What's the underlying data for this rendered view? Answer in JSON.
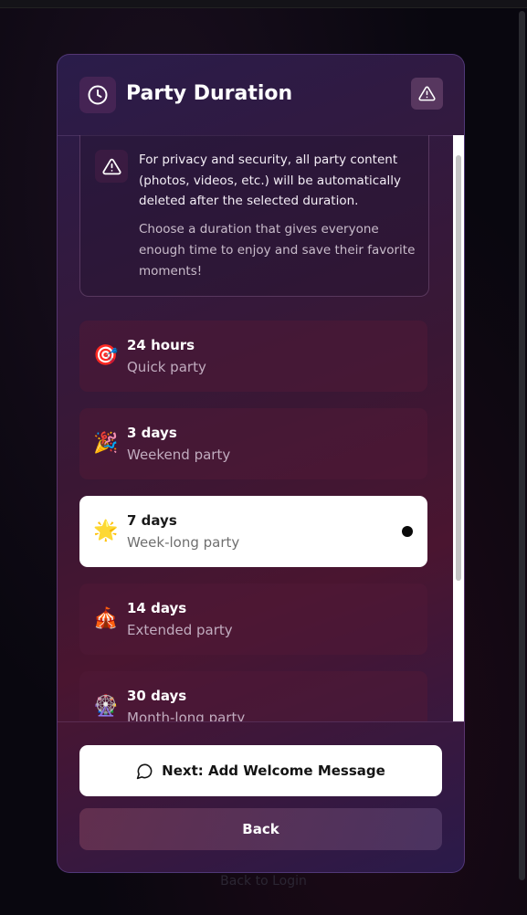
{
  "background": {
    "link_text": "Back to Login"
  },
  "modal": {
    "title": "Party Duration",
    "header_icon": "clock-icon",
    "header_button_icon": "warning-icon",
    "info": {
      "icon": "warning-icon",
      "paragraph1": "For privacy and security, all party content (photos, videos, etc.) will be automatically deleted after the selected duration.",
      "paragraph2": "Choose a duration that gives everyone enough time to enjoy and save their favorite moments!"
    },
    "options": [
      {
        "emoji": "🎯",
        "title": "24 hours",
        "subtitle": "Quick party",
        "selected": false
      },
      {
        "emoji": "🎉",
        "title": "3 days",
        "subtitle": "Weekend party",
        "selected": false
      },
      {
        "emoji": "🌟",
        "title": "7 days",
        "subtitle": "Week-long party",
        "selected": true
      },
      {
        "emoji": "🎪",
        "title": "14 days",
        "subtitle": "Extended party",
        "selected": false
      },
      {
        "emoji": "🎡",
        "title": "30 days",
        "subtitle": "Month-long party",
        "selected": false
      }
    ],
    "next_button_label": "Next: Add Welcome Message",
    "next_button_icon": "message-circle-icon",
    "back_button_label": "Back"
  },
  "colors": {
    "selected_option_bg": "#ffffff",
    "option_bg": "#50193a",
    "accent_border": "#6e50a0"
  }
}
